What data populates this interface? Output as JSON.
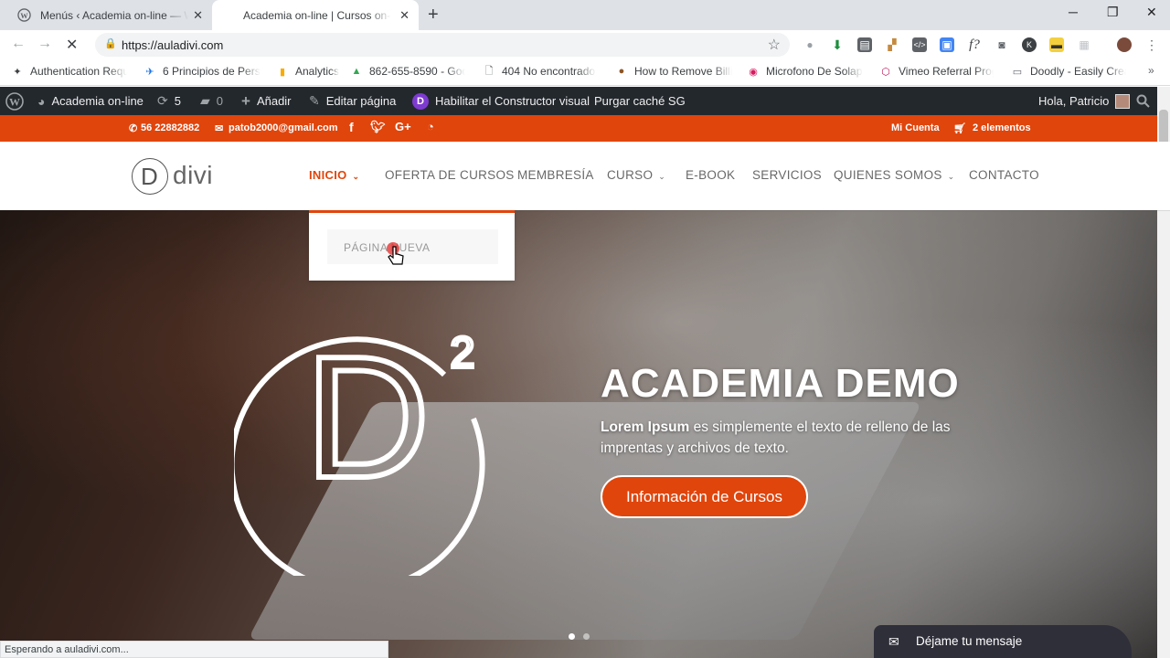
{
  "browser": {
    "tabs": [
      {
        "title": "Menús ‹ Academia on-line — Wo",
        "active": false
      },
      {
        "title": "Academia on-line | Cursos on-line",
        "active": true
      }
    ],
    "url": "https://auladivi.com",
    "bookmarks": [
      "Authentication Requ",
      "6 Principios de Persu",
      "Analytics",
      "862-655-8590 - Goo",
      "404 No encontrado",
      "How to Remove Billin",
      "Microfono De Solapa",
      "Vimeo Referral Progr",
      "Doodly - Easily Creat"
    ],
    "extension_badge": "2",
    "status_text": "Esperando a auladivi.com..."
  },
  "adminbar": {
    "site": "Academia on-line",
    "updates": "5",
    "comments": "0",
    "add": "Añadir",
    "edit": "Editar página",
    "builder": "Habilitar el Constructor visual",
    "purge": "Purgar caché SG",
    "greeting": "Hola, Patricio"
  },
  "topbar": {
    "phone": "56 22882882",
    "email": "patob2000@gmail.com",
    "account": "Mi Cuenta",
    "cart": "2 elementos"
  },
  "header": {
    "logo_letter": "D",
    "logo_text": "divi",
    "menu": [
      {
        "label": "INICIO",
        "active": true,
        "has_children": true
      },
      {
        "label": "OFERTA DE CURSOS",
        "active": false,
        "has_children": false
      },
      {
        "label": "MEMBRESÍA",
        "active": false,
        "has_children": false
      },
      {
        "label": "CURSO",
        "active": false,
        "has_children": true
      },
      {
        "label": "E-BOOK",
        "active": false,
        "has_children": false
      },
      {
        "label": "SERVICIOS",
        "active": false,
        "has_children": false
      },
      {
        "label": "QUIENES SOMOS",
        "active": false,
        "has_children": true
      },
      {
        "label": "CONTACTO",
        "active": false,
        "has_children": false
      }
    ],
    "dropdown_item": "PÁGINA NUEVA"
  },
  "hero": {
    "logo_letter": "D",
    "logo_sup": "2",
    "title": "ACADEMIA DEMO",
    "subtitle_bold": "Lorem Ipsum",
    "subtitle_rest": " es simplemente el texto de relleno de las imprentas y archivos de texto.",
    "button": "Información de Cursos",
    "slides": 2,
    "active_slide": 1
  },
  "chat": {
    "label": "Déjame tu mensaje"
  },
  "colors": {
    "accent": "#e0450c",
    "adminbar": "#23282d",
    "chat": "#2f2f3a"
  }
}
